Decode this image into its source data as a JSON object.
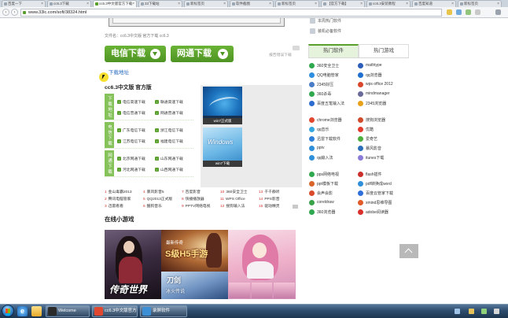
{
  "colors": {
    "accent": "#5aa02c",
    "link": "#2a6bbf",
    "cursor_highlight": "#f6dc18"
  },
  "browser": {
    "tabs": [
      {
        "label": "百度一下",
        "active": false
      },
      {
        "label": "cc6.3下载",
        "active": false
      },
      {
        "label": "cc6.3中文版官方下载",
        "active": true
      },
      {
        "label": "33下载站",
        "active": false
      },
      {
        "label": "新标签页",
        "active": false
      },
      {
        "label": "软件截图",
        "active": false
      },
      {
        "label": "新标签页",
        "active": false
      },
      {
        "label": "【官方下载】",
        "active": false
      },
      {
        "label": "cc6.3安装教程",
        "active": false
      },
      {
        "label": "百度知道",
        "active": false
      },
      {
        "label": "新标签页",
        "active": false
      }
    ],
    "url": "www.33lc.com/soft/38324.html"
  },
  "page": {
    "file_info": "文件名：cc6.3中文版   官方下载   cc6.3",
    "btn_telecom": "电信下载",
    "btn_netcom": "网通下载",
    "report": "报告错误下载",
    "download_link": "下载地址",
    "soft_title": "cc6.3中文版 官方版",
    "download_groups": [
      {
        "tab": "下载地址",
        "links": [
          "电信高速下载",
          "联通高速下载",
          "电信普通下载",
          "网通普通下载"
        ]
      },
      {
        "tab": "电信下载",
        "links": [
          "广东电信下载",
          "浙江电信下载",
          "江苏电信下载",
          "福建电信下载"
        ]
      },
      {
        "tab": "网通下载",
        "links": [
          "北京网通下载",
          "山东网通下载",
          "河北网通下载",
          "山西网通下载"
        ]
      }
    ],
    "screenshots": [
      {
        "caption": "win7正式版"
      },
      {
        "caption": "win7下载",
        "logo_text": "Windows"
      }
    ],
    "top_list": [
      {
        "num": "1",
        "name": "金山毒霸2013"
      },
      {
        "num": "2",
        "name": "腾讯电脑管家"
      },
      {
        "num": "3",
        "name": "迅雷看看"
      },
      {
        "num": "4",
        "name": "暴风影音5"
      },
      {
        "num": "5",
        "name": "QQ2013正式版"
      },
      {
        "num": "6",
        "name": "酷狗音乐"
      },
      {
        "num": "7",
        "name": "百度影音"
      },
      {
        "num": "8",
        "name": "快播播放器"
      },
      {
        "num": "9",
        "name": "PPTV网络电视"
      },
      {
        "num": "10",
        "name": "360安全卫士"
      },
      {
        "num": "11",
        "name": "WPS Office"
      },
      {
        "num": "12",
        "name": "搜狗输入法"
      },
      {
        "num": "13",
        "name": "千千静听"
      },
      {
        "num": "14",
        "name": "PPS影音"
      },
      {
        "num": "15",
        "name": "驱动精灵"
      }
    ],
    "games_heading": "在线小游戏",
    "games": {
      "game1_title": "传奇世界",
      "game2_sub": "最新传奇",
      "game2_title": "S级H5手游",
      "game3_title": "刀剑",
      "game3_sub": "冰火传说"
    }
  },
  "sidebar": {
    "top_links": [
      "本周热门软件",
      "装机必备软件"
    ],
    "tabs": [
      {
        "label": "热门软件",
        "active": true
      },
      {
        "label": "热门游戏",
        "active": false
      }
    ],
    "groups": [
      [
        {
          "name": "360安全卫士",
          "color": "#2fa84f"
        },
        {
          "name": "mathtype",
          "color": "#2c5db8"
        },
        {
          "name": "QQ电脑管家",
          "color": "#2d8ee0"
        },
        {
          "name": "qq浏览器",
          "color": "#1f6fd0"
        },
        {
          "name": "2345好压",
          "color": "#4a7cc7"
        },
        {
          "name": "wps office 2012",
          "color": "#d9462b"
        },
        {
          "name": "360杀毒",
          "color": "#2fa84f"
        },
        {
          "name": "mindmanager",
          "color": "#6a6a9a"
        },
        {
          "name": "百度五笔输入法",
          "color": "#2c6cd1"
        },
        {
          "name": "2345浏览器",
          "color": "#e8a21a"
        }
      ],
      [
        {
          "name": "chrome浏览器",
          "color": "#e0482f"
        },
        {
          "name": "搜狗浏览器",
          "color": "#d04b2a"
        },
        {
          "name": "qq音乐",
          "color": "#35a8e0"
        },
        {
          "name": "优酷",
          "color": "#e33b2e"
        },
        {
          "name": "迅雷下载软件",
          "color": "#2f7fd8"
        },
        {
          "name": "爱奇艺",
          "color": "#4cae3c"
        },
        {
          "name": "pptv",
          "color": "#2f8fd9"
        },
        {
          "name": "暴风影音",
          "color": "#2c6fb8"
        },
        {
          "name": "qq输入法",
          "color": "#2f8fd9"
        },
        {
          "name": "itunes下载",
          "color": "#8a7bd8"
        }
      ],
      [
        {
          "name": "pps网络电视",
          "color": "#2fa84f"
        },
        {
          "name": "flash插件",
          "color": "#c9302c"
        },
        {
          "name": "ppt模板下载",
          "color": "#d9642b"
        },
        {
          "name": "pdf转换成word",
          "color": "#2f8fd9"
        },
        {
          "name": "会声会影",
          "color": "#d94a2b"
        },
        {
          "name": "百度云管家下载",
          "color": "#2f6fd9"
        },
        {
          "name": "coreldraw",
          "color": "#3aa34a"
        },
        {
          "name": "xmind思维导图",
          "color": "#e05a2a"
        },
        {
          "name": "360浏览器",
          "color": "#2fa84f"
        },
        {
          "name": "adobe阅读器",
          "color": "#d9302b"
        }
      ]
    ]
  },
  "taskbar": {
    "ie_glyph": "e",
    "windows": [
      {
        "label": "Welcome",
        "icon_color": "#2b2b2b"
      },
      {
        "label": "cc6.3中文版官方下载 - Google Chrome",
        "icon_color": "#e0482f"
      },
      {
        "label": "录屏软件",
        "icon_color": "#3d8fd6"
      }
    ],
    "tray_colors": [
      "#9fc3e6",
      "#e6c35a",
      "#8fd07a",
      "#d6d6d6"
    ]
  }
}
